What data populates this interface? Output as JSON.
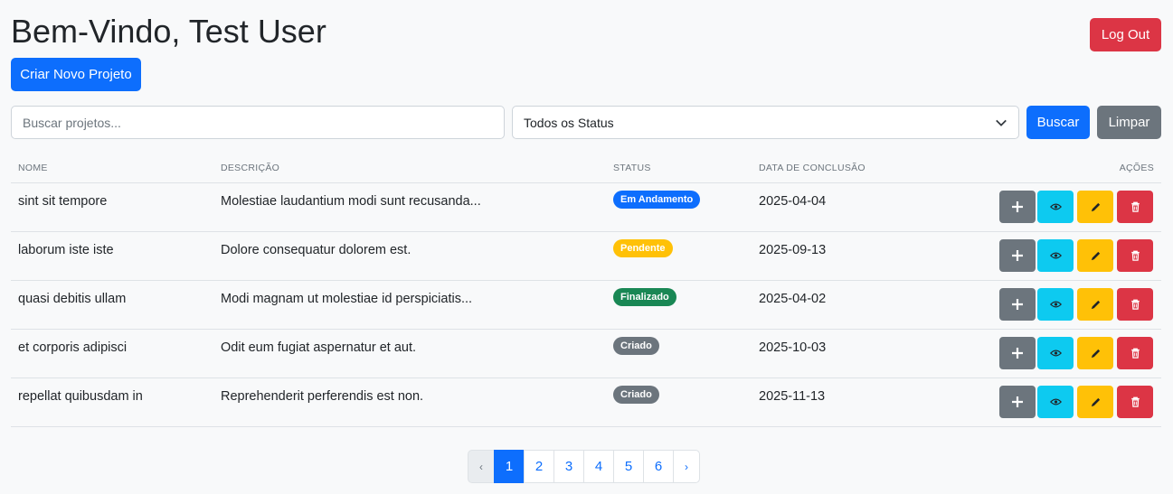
{
  "header": {
    "title": "Bem-Vindo, Test User",
    "logout_label": "Log Out",
    "new_project_label": "Criar Novo Projeto"
  },
  "filters": {
    "search_placeholder": "Buscar projetos...",
    "status_selected": "Todos os Status",
    "search_button": "Buscar",
    "clear_button": "Limpar"
  },
  "table": {
    "columns": [
      "NOME",
      "DESCRIÇÃO",
      "STATUS",
      "DATA DE CONCLUSÃO",
      "AÇÕES"
    ],
    "rows": [
      {
        "name": "sint sit tempore",
        "description": "Molestiae laudantium modi sunt recusanda...",
        "status": "Em Andamento",
        "status_color": "#0d6efd",
        "date": "2025-04-04"
      },
      {
        "name": "laborum iste iste",
        "description": "Dolore consequatur dolorem est.",
        "status": "Pendente",
        "status_color": "#ffc107",
        "date": "2025-09-13"
      },
      {
        "name": "quasi debitis ullam",
        "description": "Modi magnam ut molestiae id perspiciatis...",
        "status": "Finalizado",
        "status_color": "#198754",
        "date": "2025-04-02"
      },
      {
        "name": "et corporis adipisci",
        "description": "Odit eum fugiat aspernatur et aut.",
        "status": "Criado",
        "status_color": "#6c757d",
        "date": "2025-10-03"
      },
      {
        "name": "repellat quibusdam in",
        "description": "Reprehenderit perferendis est non.",
        "status": "Criado",
        "status_color": "#6c757d",
        "date": "2025-11-13"
      }
    ],
    "action_icons": [
      "plus-icon",
      "eye-icon",
      "pencil-icon",
      "trash-icon"
    ]
  },
  "pagination": {
    "prev": "‹",
    "next": "›",
    "pages": [
      "1",
      "2",
      "3",
      "4",
      "5",
      "6"
    ],
    "current": "1"
  },
  "colors": {
    "primary": "#0d6efd",
    "danger": "#dc3545",
    "secondary": "#6c757d",
    "info": "#0dcaf0",
    "warning": "#ffc107",
    "success": "#198754"
  }
}
